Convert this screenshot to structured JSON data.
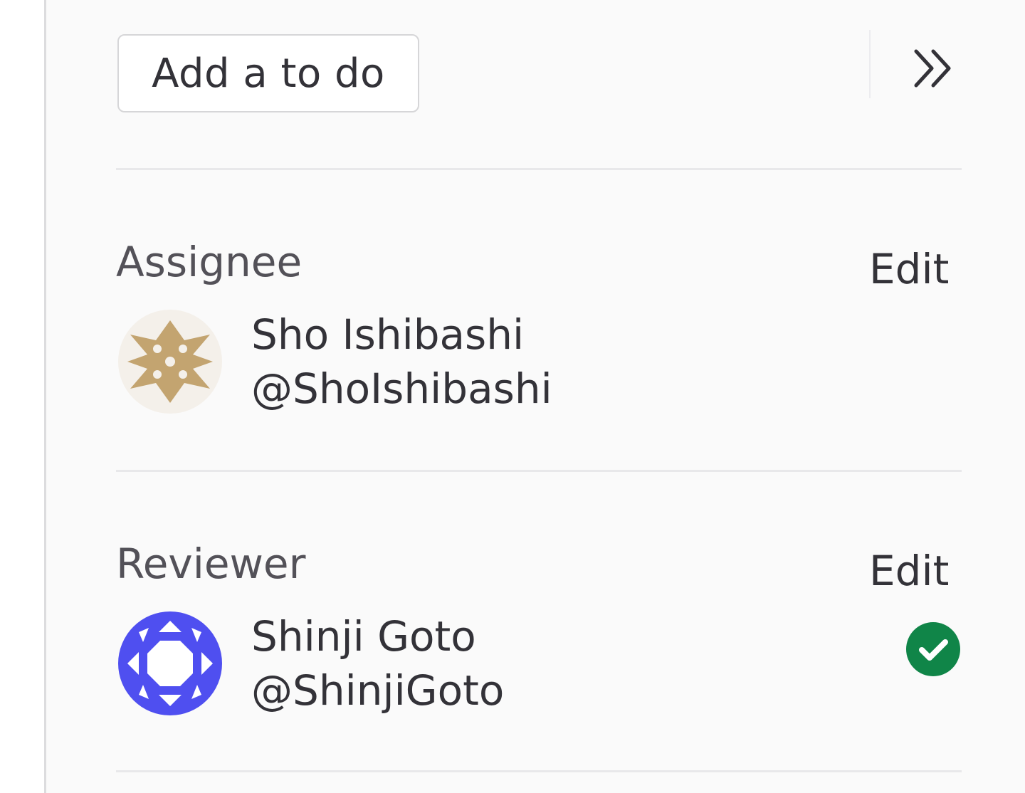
{
  "todo": {
    "label": "Add a to do"
  },
  "collapse": {
    "icon": "chevron-double-right-icon"
  },
  "assignee": {
    "label": "Assignee",
    "edit_label": "Edit",
    "user": {
      "name": "Sho Ishibashi",
      "handle": "@ShoIshibashi",
      "avatar_color": "#c3a470"
    }
  },
  "reviewer": {
    "label": "Reviewer",
    "edit_label": "Edit",
    "user": {
      "name": "Shinji Goto",
      "handle": "@ShinjiGoto",
      "avatar_color": "#4f4ff0",
      "status_icon": "check-circle-icon",
      "status_color": "#108548"
    }
  }
}
